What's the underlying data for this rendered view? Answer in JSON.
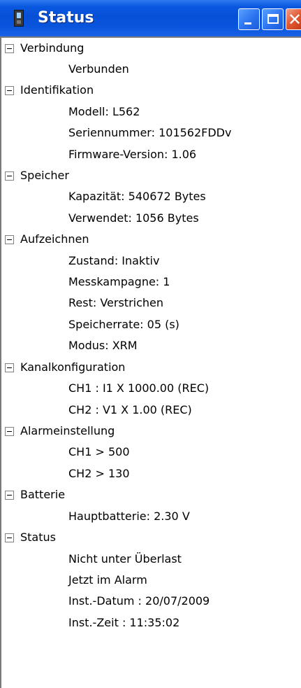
{
  "window": {
    "title": "Status",
    "icon": "device-icon",
    "buttons": {
      "minimize": "minimize-icon",
      "maximize": "maximize-icon",
      "close": "close-icon"
    }
  },
  "tree": [
    {
      "label": "Verbindung",
      "children": [
        "Verbunden"
      ]
    },
    {
      "label": "Identifikation",
      "children": [
        "Modell: L562",
        "Seriennummer: 101562FDDv",
        "Firmware-Version: 1.06"
      ]
    },
    {
      "label": "Speicher",
      "children": [
        "Kapazität: 540672 Bytes",
        "Verwendet: 1056 Bytes"
      ]
    },
    {
      "label": "Aufzeichnen",
      "children": [
        "Zustand: Inaktiv",
        "Messkampagne: 1",
        "Rest: Verstrichen",
        "Speicherrate: 05 (s)",
        "Modus: XRM"
      ]
    },
    {
      "label": "Kanalkonfiguration",
      "children": [
        "CH1 : I1 X 1000.00 (REC)",
        "CH2 : V1 X 1.00 (REC)"
      ]
    },
    {
      "label": "Alarmeinstellung",
      "children": [
        "CH1 > 500",
        "CH2 > 130"
      ]
    },
    {
      "label": "Batterie",
      "children": [
        "Hauptbatterie: 2.30 V"
      ]
    },
    {
      "label": "Status",
      "children": [
        "Nicht unter Überlast",
        "Jetzt im Alarm",
        "Inst.-Datum : 20/07/2009",
        "Inst.-Zeit : 11:35:02"
      ]
    }
  ]
}
